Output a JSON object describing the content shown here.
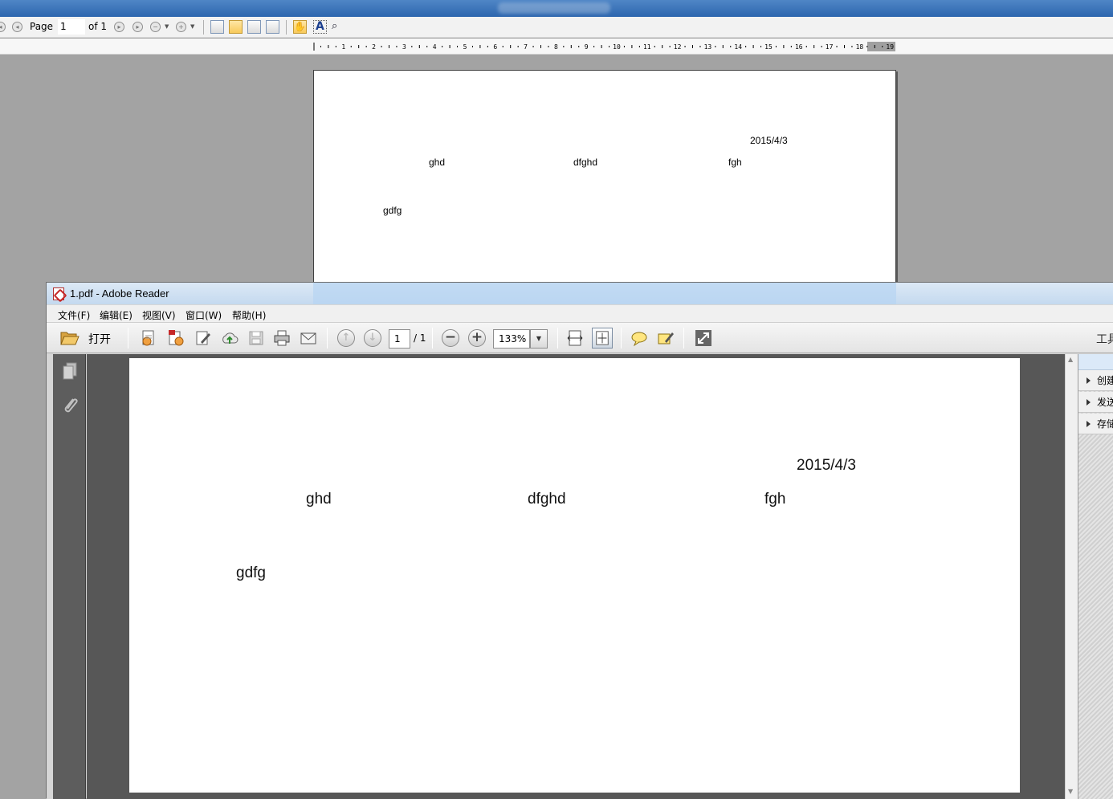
{
  "background_window": {
    "toolbar": {
      "page_label": "Page",
      "page_value": "1",
      "of_label": "of 1"
    },
    "ruler_labels": [
      "1",
      "2",
      "3",
      "4",
      "5",
      "6",
      "7",
      "8",
      "9",
      "10",
      "11",
      "12",
      "13",
      "14",
      "15",
      "16",
      "17",
      "18",
      "19"
    ],
    "document": {
      "date": "2015/4/3",
      "cells": [
        "ghd",
        "dfghd",
        "fgh"
      ],
      "footer_text": "gdfg"
    }
  },
  "reader_window": {
    "title": "1.pdf - Adobe Reader",
    "menu": [
      "文件(F)",
      "编辑(E)",
      "视图(V)",
      "窗口(W)",
      "帮助(H)"
    ],
    "toolbar": {
      "open_label": "打开",
      "page_value": "1",
      "page_total": "/ 1",
      "zoom_value": "133%",
      "tools_label": "工具"
    },
    "document": {
      "date": "2015/4/3",
      "cells": [
        "ghd",
        "dfghd",
        "fgh"
      ],
      "footer_text": "gdfg"
    },
    "right_panel": [
      "创建",
      "发送",
      "存储"
    ],
    "icons": {
      "open": "folder-open-icon",
      "create": "create-pdf-icon",
      "edit": "edit-icon",
      "upload": "cloud-upload-icon",
      "save": "save-icon",
      "print": "print-icon",
      "email": "email-icon"
    }
  }
}
